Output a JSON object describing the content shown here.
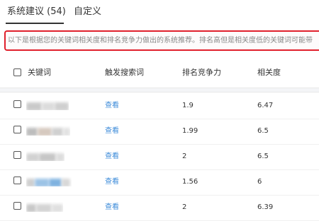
{
  "tabs": [
    {
      "label": "系统建议 (54)",
      "active": true
    },
    {
      "label": "自定义",
      "active": false
    }
  ],
  "banner": {
    "text": "以下是根据您的关键词相关度和排名竞争力做出的系统推荐。排名高但是相关度低的关键词可能带",
    "border_color": "#e0202c"
  },
  "table": {
    "columns": [
      "关键词",
      "触发搜索词",
      "排名竞争力",
      "相关度"
    ],
    "rows": [
      {
        "trigger": "查看",
        "competitiveness": "1.9",
        "relevance": "6.47"
      },
      {
        "trigger": "查看",
        "competitiveness": "1.99",
        "relevance": "6.5"
      },
      {
        "trigger": "查看",
        "competitiveness": "2",
        "relevance": "6.5"
      },
      {
        "trigger": "查看",
        "competitiveness": "1.56",
        "relevance": "6"
      },
      {
        "trigger": "查看",
        "competitiveness": "2",
        "relevance": "6.39"
      }
    ]
  },
  "colors": {
    "link": "#3c8bd9",
    "highlight_border": "#e0202c"
  }
}
